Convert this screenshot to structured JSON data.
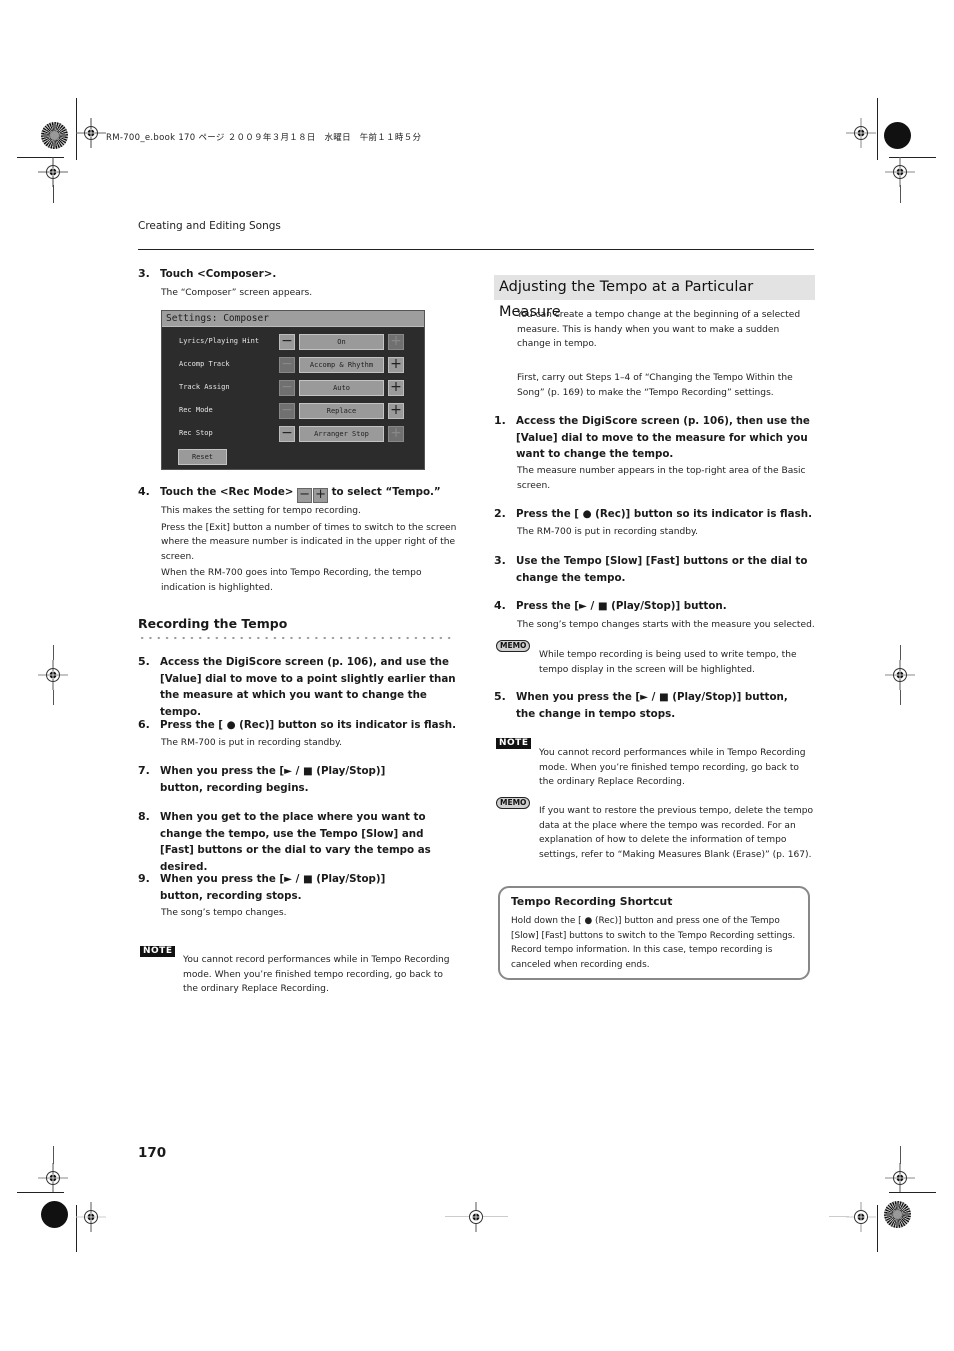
{
  "print_header": "RM-700_e.book  170 ページ  ２００９年３月１８日　水曜日　午前１１時５分",
  "running_head": "Creating and Editing Songs",
  "page_number": "170",
  "left": {
    "step3": {
      "num": "3.",
      "title": "Touch <Composer>.",
      "body": "The “Composer” screen appears."
    },
    "composer_screen": {
      "title": "Settings: Composer",
      "rows": [
        {
          "label": "Lyrics/Playing Hint",
          "value": "On",
          "minus_enabled": true,
          "plus_enabled": false
        },
        {
          "label": "Accomp Track",
          "value": "Accomp & Rhythm",
          "minus_enabled": false,
          "plus_enabled": true
        },
        {
          "label": "Track Assign",
          "value": "Auto",
          "minus_enabled": false,
          "plus_enabled": true
        },
        {
          "label": "Rec Mode",
          "value": "Replace",
          "minus_enabled": false,
          "plus_enabled": true
        },
        {
          "label": "Rec Stop",
          "value": "Arranger Stop",
          "minus_enabled": true,
          "plus_enabled": false
        }
      ],
      "minus_glyph": "−",
      "plus_glyph": "+",
      "reset_label": "Reset"
    },
    "step4": {
      "num": "4.",
      "title_pre": "Touch the <Rec Mode>",
      "title_post": "to select “Tempo.”",
      "body": [
        "This makes the setting for tempo recording.",
        "Press the [Exit] button a number of times to switch to the screen where the measure number is indicated in the upper right of the screen.",
        "When the RM-700 goes into Tempo Recording, the tempo indication is highlighted."
      ]
    },
    "subheading": "Recording the Tempo",
    "steps": [
      {
        "num": "5.",
        "title": "Access the DigiScore screen (p. 106), and use the [Value] dial to move to a point slightly earlier than the measure at which you want to change the tempo.",
        "body": ""
      },
      {
        "num": "6.",
        "title": "Press the [ ● (Rec)] button so its indicator is flash.",
        "body": "The RM-700 is put in recording standby."
      },
      {
        "num": "7.",
        "title": "When you press the [► / ■ (Play/Stop)] button, recording begins.",
        "body": ""
      },
      {
        "num": "8.",
        "title": "When you get to the place where you want to change the tempo, use the Tempo [Slow] and [Fast] buttons or the dial to vary the tempo as desired.",
        "body": ""
      },
      {
        "num": "9.",
        "title": "When you press the [► / ■ (Play/Stop)] button, recording stops.",
        "body": "The song’s tempo changes."
      }
    ],
    "note": {
      "badge": "NOTE",
      "text": "You cannot record performances while in Tempo Recording mode. When you’re finished tempo recording, go back to the ordinary Replace Recording."
    }
  },
  "right": {
    "section_title": "Adjusting the Tempo at a Particular Measure",
    "intro": "You can create a tempo change at the beginning of a selected measure. This is handy when you want to make a sudden change in tempo.",
    "prereq": "First, carry out Steps 1–4 of “Changing the Tempo Within the Song” (p. 169) to make the “Tempo Recording” settings.",
    "steps": [
      {
        "num": "1.",
        "title": "Access the DigiScore screen (p. 106), then use the [Value] dial to move to the measure for which you want to change the tempo.",
        "body": "The measure number appears in the top-right area of the Basic screen."
      },
      {
        "num": "2.",
        "title": "Press the [ ● (Rec)] button so its indicator is flash.",
        "body": "The RM-700 is put in recording standby."
      },
      {
        "num": "3.",
        "title": "Use the Tempo [Slow] [Fast] buttons or the dial to change the tempo.",
        "body": ""
      },
      {
        "num": "4.",
        "title": "Press the [► / ■ (Play/Stop)] button.",
        "body": "The song’s tempo changes starts with the measure you selected."
      },
      {
        "num": "5.",
        "title": "When you press the [► / ■ (Play/Stop)] button, the change in tempo stops.",
        "body": ""
      }
    ],
    "memo1": {
      "badge": "MEMO",
      "text": "While tempo recording is being used to write tempo, the tempo display in the screen will be highlighted."
    },
    "note": {
      "badge": "NOTE",
      "text": "You cannot record performances while in Tempo Recording mode. When you’re finished tempo recording, go back to the ordinary Replace Recording."
    },
    "memo2": {
      "badge": "MEMO",
      "text": "If you want to restore the previous tempo, delete the tempo data at the place where the tempo was recorded. For an explanation of how to delete the information of tempo settings, refer to “Making Measures Blank (Erase)” (p. 167)."
    },
    "shortcut": {
      "title": "Tempo Recording Shortcut",
      "body": "Hold down the [ ● (Rec)] button and press one of the Tempo [Slow] [Fast] buttons to switch to the Tempo Recording settings. Record tempo information. In this case, tempo recording is canceled when recording ends."
    }
  }
}
